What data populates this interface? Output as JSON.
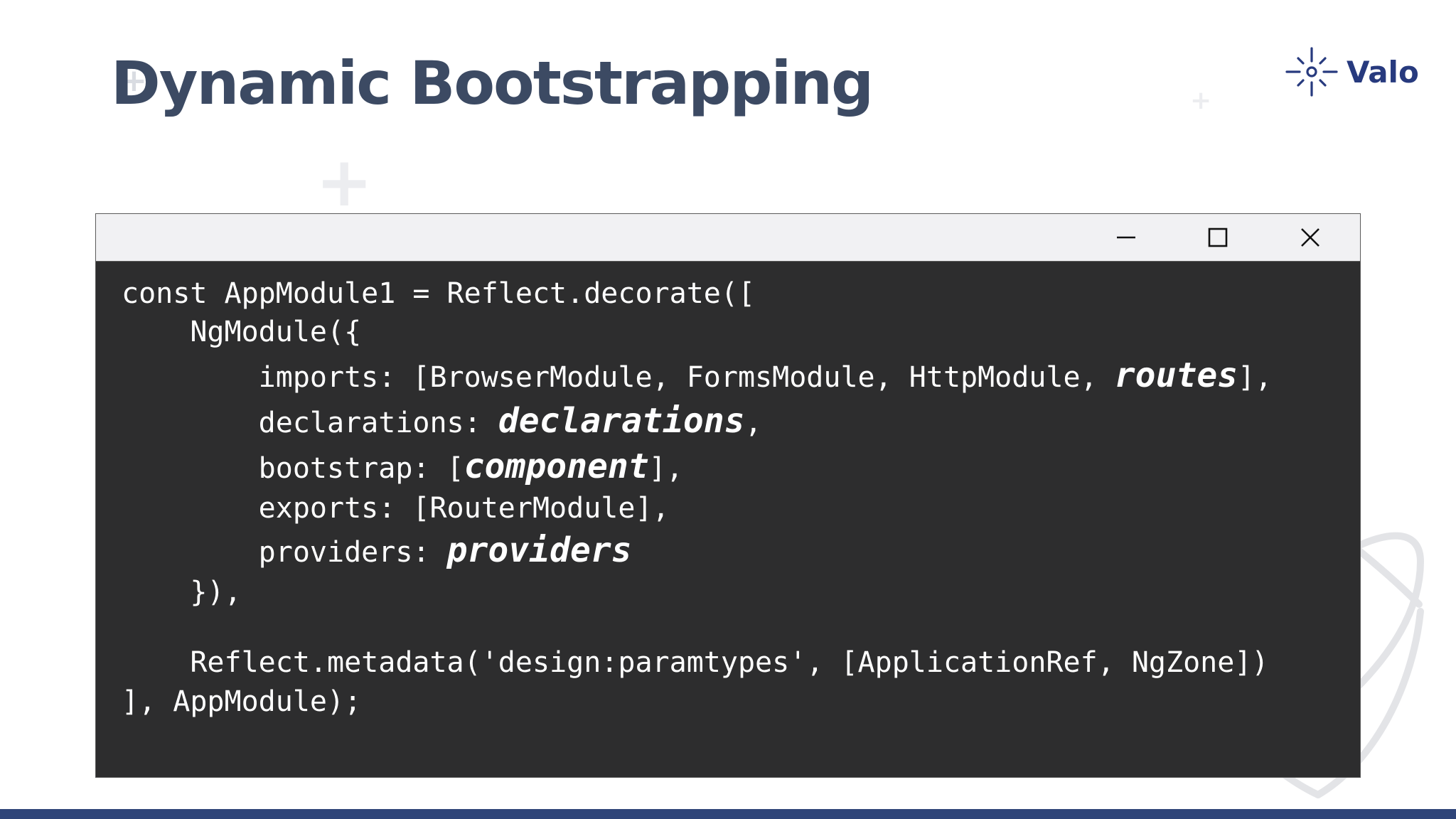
{
  "slide": {
    "title": "Dynamic Bootstrapping"
  },
  "logo": {
    "text": "Valo",
    "icon": "valo-star-icon",
    "color": "#273a7e"
  },
  "window": {
    "controls": {
      "minimize_icon": "minimize-icon",
      "maximize_icon": "maximize-icon",
      "close_icon": "close-icon"
    },
    "code": {
      "l1": "const AppModule1 = Reflect.decorate([",
      "l2": "    NgModule({",
      "l3_pre": "        imports: [BrowserModule, FormsModule, HttpModule, ",
      "l3_em": "routes",
      "l3_post": "],",
      "l4_pre": "        declarations: ",
      "l4_em": "declarations",
      "l4_post": ",",
      "l5_pre": "        bootstrap: [",
      "l5_em": "component",
      "l5_post": "],",
      "l6": "        exports: [RouterModule],",
      "l7_pre": "        providers: ",
      "l7_em": "providers",
      "l8": "    }),",
      "l9": "    Reflect.metadata('design:paramtypes', [ApplicationRef, NgZone])",
      "l10": "], AppModule);"
    }
  },
  "colors": {
    "title": "#3c4a63",
    "code_background": "#2d2d2e",
    "titlebar_background": "#f1f1f3",
    "bottom_bar": "#2f4579"
  }
}
